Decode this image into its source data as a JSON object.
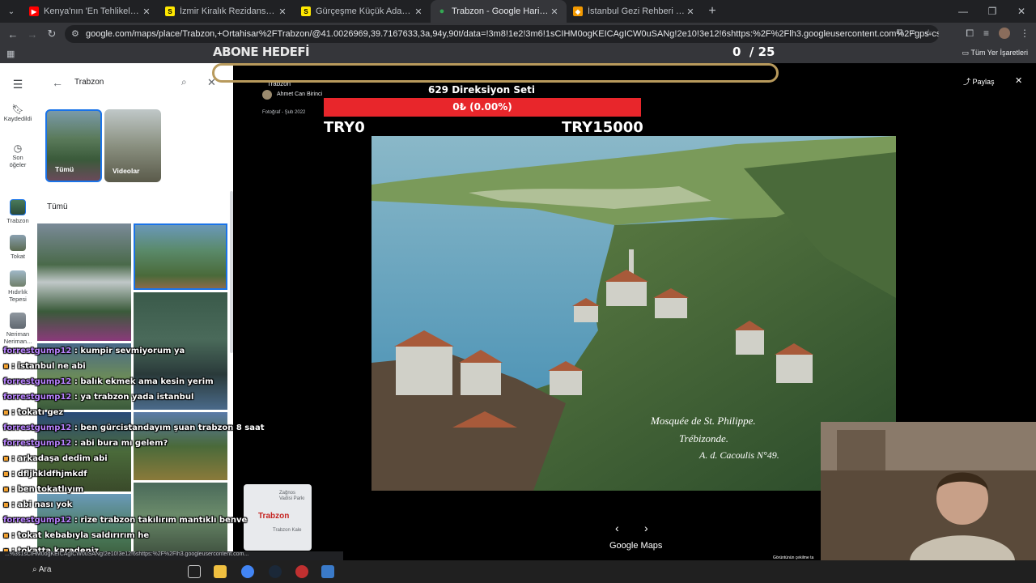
{
  "browser": {
    "tabs": [
      {
        "title": "Kenya'nın 'En Tehlikeli' Mahalles",
        "favicon": "youtube-icon",
        "color": "#ff0000"
      },
      {
        "title": "İzmir Kiralık Rezidans, Villa, Mü",
        "favicon": "sahibinden-icon",
        "color": "#ffe800"
      },
      {
        "title": "Gürçeşme Küçük Ada Mahalles",
        "favicon": "sahibinden-icon",
        "color": "#ffe800"
      },
      {
        "title": "Trabzon - Google Haritalar",
        "favicon": "maps-pin-icon",
        "color": "#34a853"
      },
      {
        "title": "İstanbul Gezi Rehberi - İstanbul",
        "favicon": "guide-icon",
        "color": "#f29900"
      }
    ],
    "url": "google.com/maps/place/Trabzon,+Ortahisar%2FTrabzon/@41.0026969,39.7167633,3a,94y,90t/data=!3m8!1e2!3m6!1sCIHM0ogKEICAgICW0uSANg!2e10!3e12!6shttps:%2F%2Flh3.googleusercontent.com%2Fgps-cs-s%2FAHVAwer1u0Hg23s...",
    "all_bookmarks": "Tüm Yer İşaretleri",
    "status_url": "...%3s1sCIHM0ogKEICAgICW0uSANg!2e10!3e12!6shttps:%2F%2Flh3.googleusercontent.com..."
  },
  "rail": {
    "saved": "Kaydedildi",
    "recent": "Son öğeler",
    "places": [
      "Trabzon",
      "Tokat",
      "Hıdırlık Tepesi",
      "Neriman Neriman..."
    ]
  },
  "panel": {
    "search_value": "Trabzon",
    "categories": [
      {
        "label": "Tümü"
      },
      {
        "label": "Videolar"
      }
    ],
    "section_title": "Tümü"
  },
  "viewer": {
    "place_title": "Trabzon",
    "author": "Ahmet Can Birinci",
    "date": "Fotoğraf - Şub 2022",
    "share_label": "Paylaş",
    "caption_line1": "Mosquée de St. Philippe.",
    "caption_line2": "Trébizonde.",
    "caption_line3": "A. d. Cacoulis N°49.",
    "google_maps": "Google Maps",
    "credit": "Görüntünün çekilme ta",
    "minimap_city": "Trabzon",
    "minimap_label1": "Zağnos Vadisi Parkı",
    "minimap_label2": "Trabzon Kale"
  },
  "overlay": {
    "goal_label": "ABONE HEDEFİ",
    "goal_current": "0",
    "goal_total": "/ 25",
    "donation_title": "629 Direksiyon Seti",
    "donation_pct": "0₺ (0.00%)",
    "donation_min": "TRY0",
    "donation_max": "TRY15000",
    "donation_progress": 0
  },
  "chat": [
    {
      "user": "forrestgump12",
      "msg": " : kumpir sevmiyorum ya",
      "color": "user1"
    },
    {
      "user": "",
      "msg": " : istanbul ne abi",
      "color": "user2"
    },
    {
      "user": "forrestgump12",
      "msg": " : balık ekmek ama kesin yerim",
      "color": "user1"
    },
    {
      "user": "forrestgump12",
      "msg": " : ya trabzon yada istanbul",
      "color": "user1"
    },
    {
      "user": "",
      "msg": " : tokatı gez",
      "color": "user2"
    },
    {
      "user": "forrestgump12",
      "msg": " : ben gürcistandayım şuan trabzon 8 saat",
      "color": "user1"
    },
    {
      "user": "forrestgump12",
      "msg": " : abi bura mı gelem?",
      "color": "user1"
    },
    {
      "user": "",
      "msg": " : arkadaşa dedim abi",
      "color": "user2"
    },
    {
      "user": "",
      "msg": " : dfljhkldfhjmkdf",
      "color": "user2"
    },
    {
      "user": "",
      "msg": " : ben tokatlıyım",
      "color": "user2"
    },
    {
      "user": "",
      "msg": " : abi nası yok",
      "color": "user2"
    },
    {
      "user": "forrestgump12",
      "msg": " : rize trabzon takılırım mantıklı benve",
      "color": "user1"
    },
    {
      "user": "",
      "msg": " : tokat kebabıyla saldırırım he",
      "color": "user2"
    },
    {
      "user": "",
      "msg": " : tokatta karadeniz",
      "color": "user2"
    }
  ],
  "taskbar": {
    "search_label": "Ara"
  }
}
